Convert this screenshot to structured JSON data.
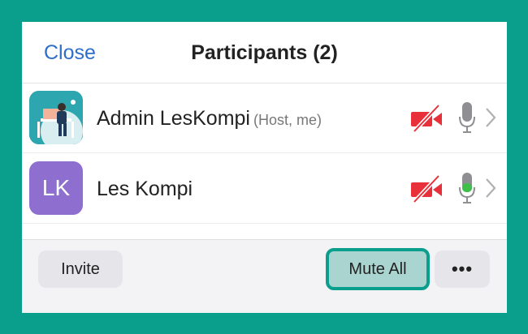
{
  "header": {
    "close_label": "Close",
    "title": "Participants (2)"
  },
  "participants": [
    {
      "name": "Admin LesKompi",
      "tag": "(Host, me)",
      "avatar": "photo",
      "video": "off",
      "mic": "muted"
    },
    {
      "name": "Les Kompi",
      "tag": "",
      "avatar": "initials",
      "initials": "LK",
      "video": "off",
      "mic": "active"
    }
  ],
  "footer": {
    "invite_label": "Invite",
    "mute_all_label": "Mute All",
    "more_label": "•••"
  },
  "colors": {
    "accent": "#0a9e8d",
    "link": "#2d6fc9",
    "video_off": "#e8303a",
    "mic_active": "#3fbf4a",
    "avatar_lk": "#8e6ecf"
  }
}
